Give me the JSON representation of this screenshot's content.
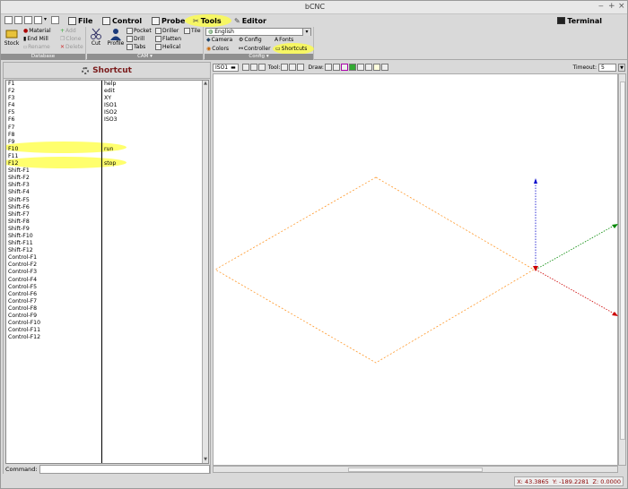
{
  "window": {
    "title": "bCNC"
  },
  "menu": {
    "tabs": [
      {
        "label": "File"
      },
      {
        "label": "Control"
      },
      {
        "label": "Probe"
      },
      {
        "label": "Tools"
      },
      {
        "label": "Editor"
      }
    ],
    "terminal_label": "Terminal",
    "highlighted_tab": "Tools"
  },
  "ribbon": {
    "database": {
      "footer": "Database",
      "stock_label": "Stock",
      "items": [
        "Material",
        "End Mill",
        "Rename"
      ],
      "items_disabled": [
        "Add",
        "Clone",
        "Delete"
      ]
    },
    "cam": {
      "footer": "CAM",
      "cut_label": "Cut",
      "profile_label": "Profile",
      "items": [
        "Pocket",
        "Drill",
        "Tabs",
        "Driller",
        "Flatten",
        "Helical",
        "Tile"
      ]
    },
    "config": {
      "footer": "Config",
      "language": "English",
      "items": [
        "Camera",
        "Config",
        "Fonts",
        "Colors",
        "Controller",
        "Shortcuts"
      ]
    }
  },
  "panel": {
    "title": "Shortcut",
    "shortcuts": [
      {
        "key": "F1",
        "value": "help"
      },
      {
        "key": "F2",
        "value": "edit"
      },
      {
        "key": "F3",
        "value": "XY"
      },
      {
        "key": "F4",
        "value": "ISO1"
      },
      {
        "key": "F5",
        "value": "ISO2"
      },
      {
        "key": "F6",
        "value": "ISO3"
      },
      {
        "key": "F7",
        "value": ""
      },
      {
        "key": "F8",
        "value": ""
      },
      {
        "key": "F9",
        "value": ""
      },
      {
        "key": "F10",
        "value": "run"
      },
      {
        "key": "F11",
        "value": ""
      },
      {
        "key": "F12",
        "value": "stop"
      },
      {
        "key": "Shift-F1",
        "value": ""
      },
      {
        "key": "Shift-F2",
        "value": ""
      },
      {
        "key": "Shift-F3",
        "value": ""
      },
      {
        "key": "Shift-F4",
        "value": ""
      },
      {
        "key": "Shift-F5",
        "value": ""
      },
      {
        "key": "Shift-F6",
        "value": ""
      },
      {
        "key": "Shift-F7",
        "value": ""
      },
      {
        "key": "Shift-F8",
        "value": ""
      },
      {
        "key": "Shift-F9",
        "value": ""
      },
      {
        "key": "Shift-F10",
        "value": ""
      },
      {
        "key": "Shift-F11",
        "value": ""
      },
      {
        "key": "Shift-F12",
        "value": ""
      },
      {
        "key": "Control-F1",
        "value": ""
      },
      {
        "key": "Control-F2",
        "value": ""
      },
      {
        "key": "Control-F3",
        "value": ""
      },
      {
        "key": "Control-F4",
        "value": ""
      },
      {
        "key": "Control-F5",
        "value": ""
      },
      {
        "key": "Control-F6",
        "value": ""
      },
      {
        "key": "Control-F7",
        "value": ""
      },
      {
        "key": "Control-F8",
        "value": ""
      },
      {
        "key": "Control-F9",
        "value": ""
      },
      {
        "key": "Control-F10",
        "value": ""
      },
      {
        "key": "Control-F11",
        "value": ""
      },
      {
        "key": "Control-F12",
        "value": ""
      }
    ],
    "command_label": "Command:",
    "command_value": ""
  },
  "canvas_toolbar": {
    "view": "ISO1",
    "tool_label": "Tool:",
    "draw_label": "Draw:",
    "timeout_label": "Timeout:",
    "timeout_value": "5"
  },
  "status": {
    "x": "X: 43.3865",
    "y": "Y: -189.2281",
    "z": "Z: 0.0000"
  },
  "colors": {
    "panel_title": "#7a1a1a",
    "coords": "#8b0000",
    "highlight": "#ffff3c",
    "workspace": "#ff9a2e",
    "axis_x": "#cc0000",
    "axis_y": "#008800",
    "axis_z": "#0000cc"
  }
}
